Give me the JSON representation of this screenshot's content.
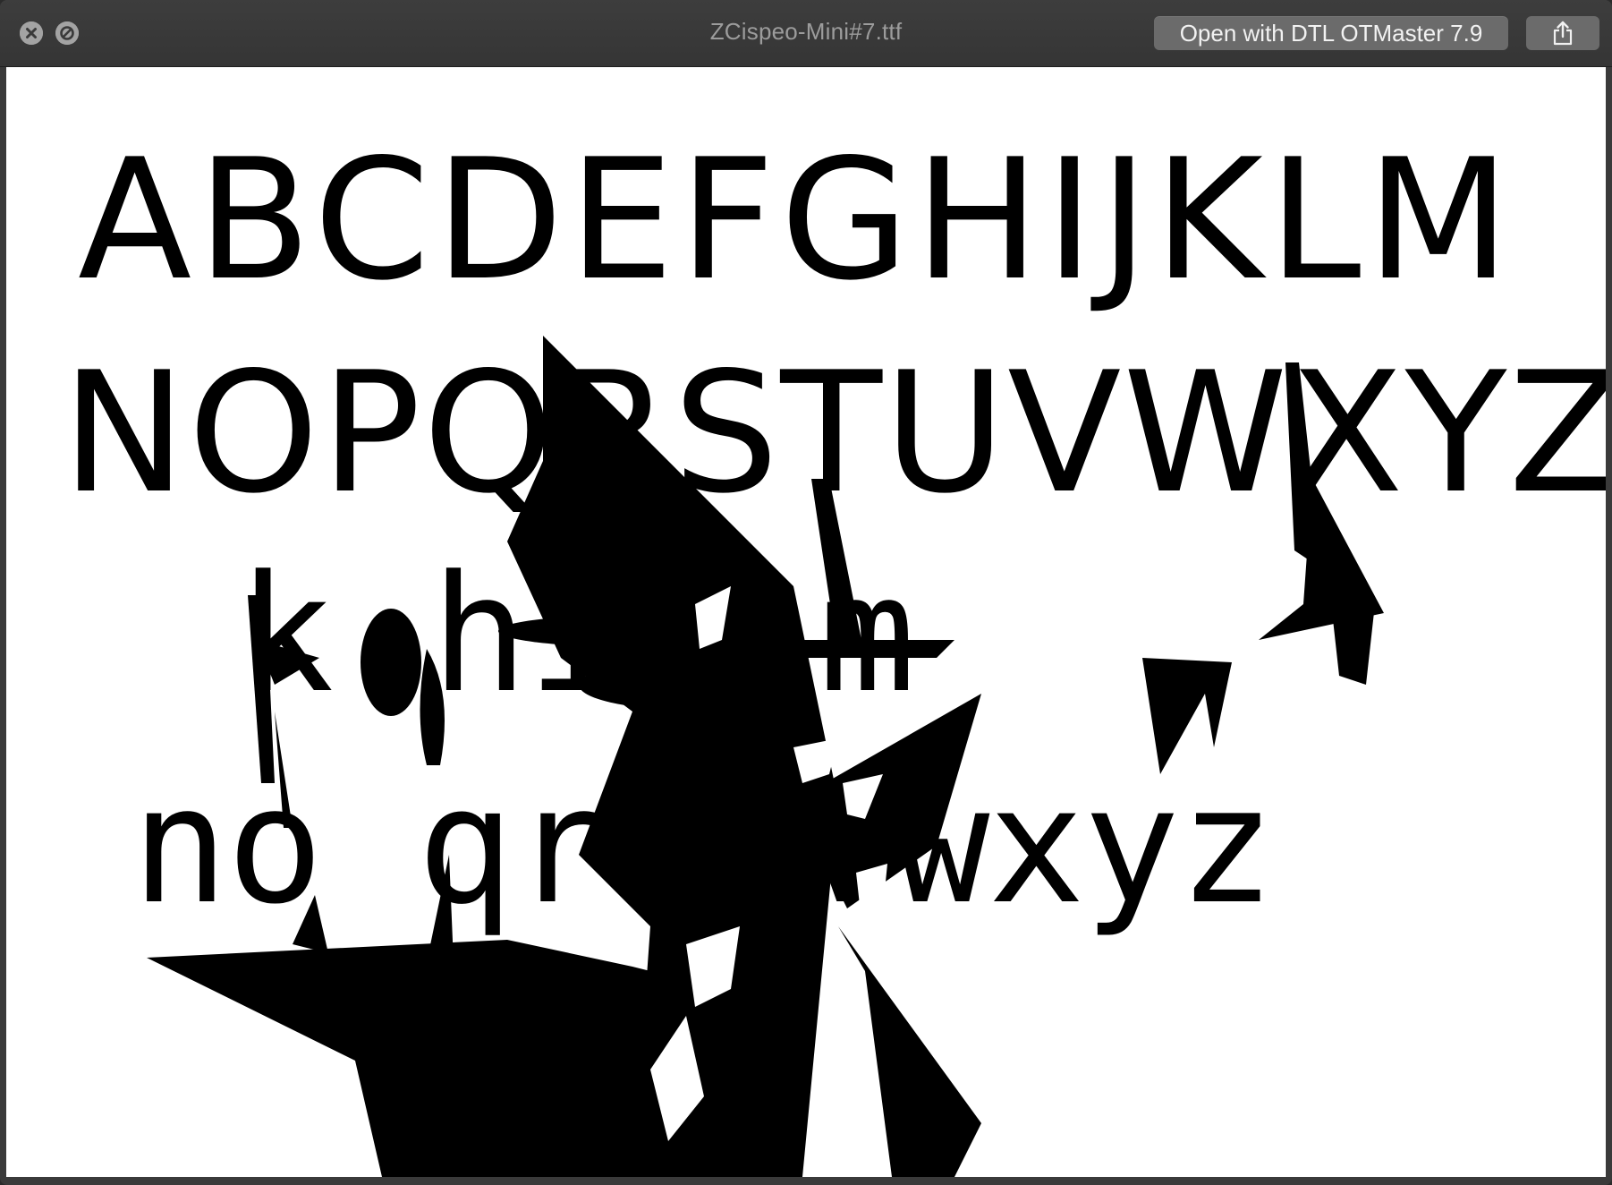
{
  "window": {
    "title": "ZCispeo-Mini#7.ttf",
    "open_button_label": "Open with DTL OTMaster 7.9",
    "close_icon": "close-icon",
    "stop_icon": "fullscreen-disabled-icon",
    "share_icon": "share-icon"
  },
  "preview": {
    "upper_row_1": "ABCDEFGHIJKLM",
    "upper_row_2": "NOPQRSTUVWXYZ",
    "lower_row_1": "k          hij  m",
    "lower_row_2": "no qrs  vwxyz",
    "background": "#ffffff",
    "glyph_color": "#000000"
  }
}
